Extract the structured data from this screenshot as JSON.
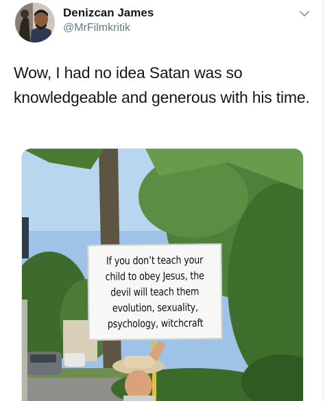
{
  "tweet": {
    "display_name": "Denizcan James",
    "handle": "@MrFilmkritik",
    "text": "Wow, I had no idea Satan was so knowledgeable and generous with his time."
  },
  "icons": {
    "menu": "chevron-down-icon"
  },
  "media": {
    "sign_lines": [
      "If you don’t teach your",
      "child to obey Jesus, the",
      "devil will teach them",
      "evolution, sexuality,",
      "psychology, witchcraft"
    ]
  },
  "colors": {
    "name": "#14171a",
    "handle": "#657786",
    "text": "#14171a"
  }
}
